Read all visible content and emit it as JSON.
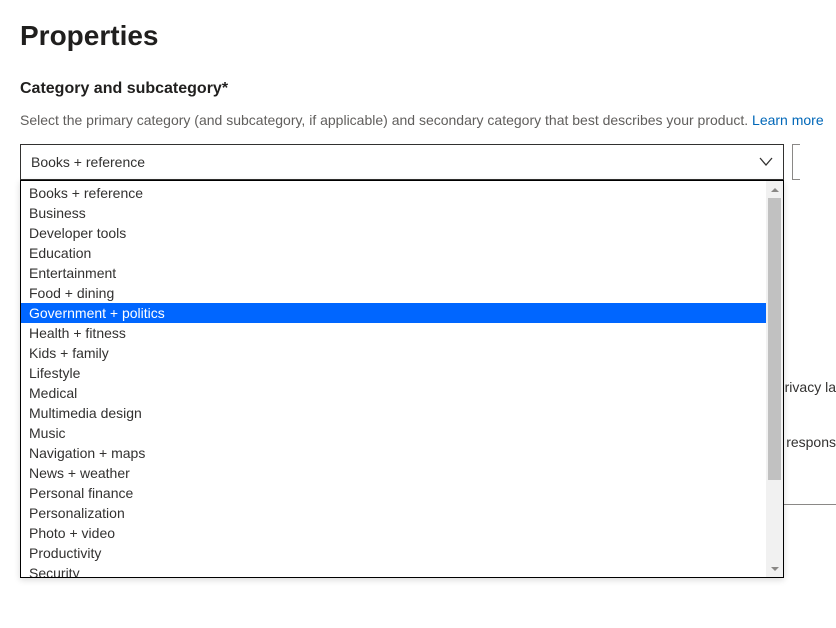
{
  "page": {
    "title": "Properties"
  },
  "section": {
    "heading": "Category and subcategory*",
    "hint_a": "Select the primary category (and subcategory, if applicable) and secondary category that best describes your product. ",
    "learn_more": "Learn more"
  },
  "select": {
    "value": "Books + reference",
    "options": [
      "Books + reference",
      "Business",
      "Developer tools",
      "Education",
      "Entertainment",
      "Food + dining",
      "Government + politics",
      "Health + fitness",
      "Kids + family",
      "Lifestyle",
      "Medical",
      "Multimedia design",
      "Music",
      "Navigation + maps",
      "News + weather",
      "Personal finance",
      "Personalization",
      "Photo + video",
      "Productivity",
      "Security"
    ],
    "highlighted_index": 6
  },
  "behind": {
    "text1": "privacy la",
    "text2": "e respons"
  }
}
